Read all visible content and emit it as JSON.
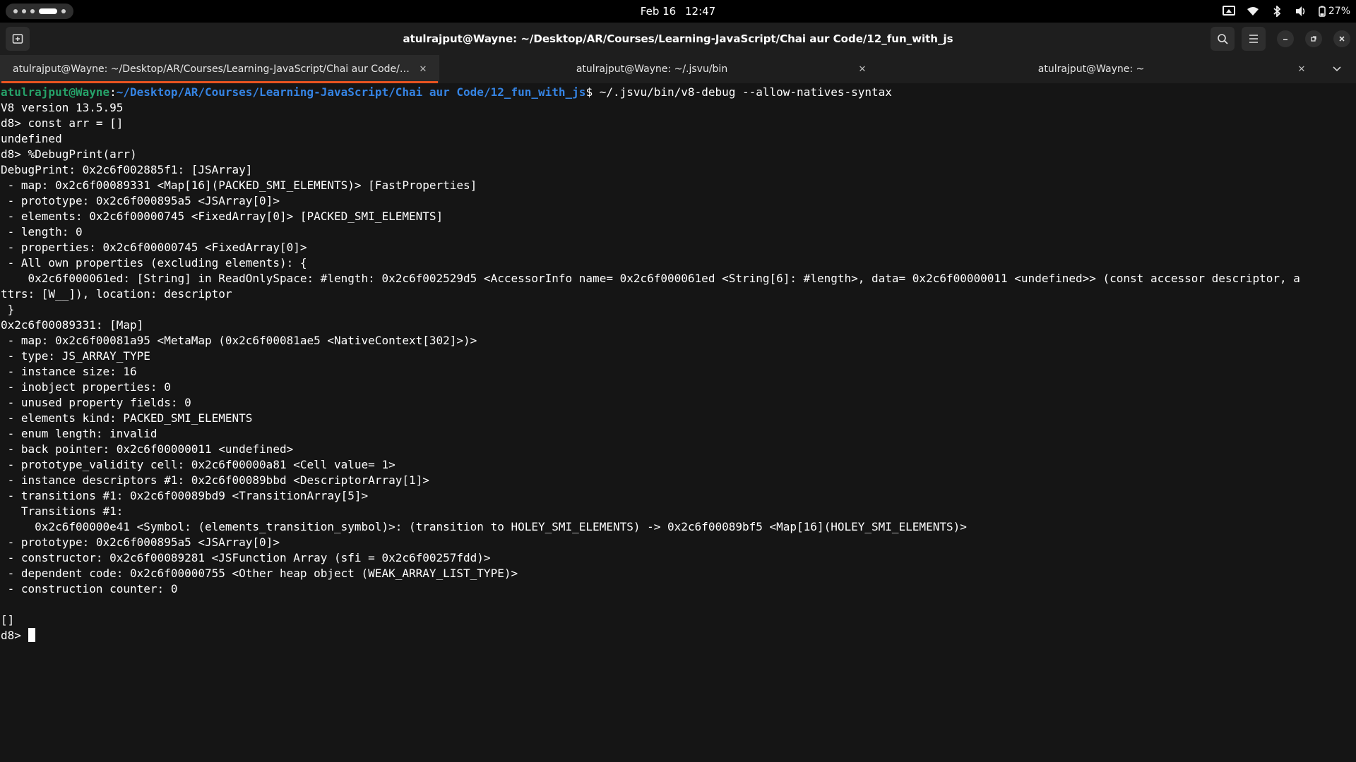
{
  "top_bar": {
    "date": "Feb 16",
    "time": "12:47",
    "battery": "27%"
  },
  "window": {
    "title": "atulrajput@Wayne: ~/Desktop/AR/Courses/Learning-JavaScript/Chai aur Code/12_fun_with_js"
  },
  "tabs": [
    {
      "label": "atulrajput@Wayne: ~/Desktop/AR/Courses/Learning-JavaScript/Chai aur Code/12_f...",
      "active": true
    },
    {
      "label": "atulrajput@Wayne: ~/.jsvu/bin",
      "active": false
    },
    {
      "label": "atulrajput@Wayne: ~",
      "active": false
    }
  ],
  "terminal": {
    "prompt_user": "atulrajput@Wayne",
    "prompt_path": "~/Desktop/AR/Courses/Learning-JavaScript/Chai aur Code/12_fun_with_js",
    "prompt_command": "$ ~/.jsvu/bin/v8-debug --allow-natives-syntax",
    "lines": [
      "V8 version 13.5.95",
      "d8> const arr = []",
      "undefined",
      "d8> %DebugPrint(arr)",
      "DebugPrint: 0x2c6f002885f1: [JSArray]",
      " - map: 0x2c6f00089331 <Map[16](PACKED_SMI_ELEMENTS)> [FastProperties]",
      " - prototype: 0x2c6f000895a5 <JSArray[0]>",
      " - elements: 0x2c6f00000745 <FixedArray[0]> [PACKED_SMI_ELEMENTS]",
      " - length: 0",
      " - properties: 0x2c6f00000745 <FixedArray[0]>",
      " - All own properties (excluding elements): {",
      "    0x2c6f000061ed: [String] in ReadOnlySpace: #length: 0x2c6f002529d5 <AccessorInfo name= 0x2c6f000061ed <String[6]: #length>, data= 0x2c6f00000011 <undefined>> (const accessor descriptor, a",
      "ttrs: [W__]), location: descriptor",
      " }",
      "0x2c6f00089331: [Map]",
      " - map: 0x2c6f00081a95 <MetaMap (0x2c6f00081ae5 <NativeContext[302]>)>",
      " - type: JS_ARRAY_TYPE",
      " - instance size: 16",
      " - inobject properties: 0",
      " - unused property fields: 0",
      " - elements kind: PACKED_SMI_ELEMENTS",
      " - enum length: invalid",
      " - back pointer: 0x2c6f00000011 <undefined>",
      " - prototype_validity cell: 0x2c6f00000a81 <Cell value= 1>",
      " - instance descriptors #1: 0x2c6f00089bbd <DescriptorArray[1]>",
      " - transitions #1: 0x2c6f00089bd9 <TransitionArray[5]>",
      "   Transitions #1:",
      "     0x2c6f00000e41 <Symbol: (elements_transition_symbol)>: (transition to HOLEY_SMI_ELEMENTS) -> 0x2c6f00089bf5 <Map[16](HOLEY_SMI_ELEMENTS)>",
      " - prototype: 0x2c6f000895a5 <JSArray[0]>",
      " - constructor: 0x2c6f00089281 <JSFunction Array (sfi = 0x2c6f00257fdd)>",
      " - dependent code: 0x2c6f00000755 <Other heap object (WEAK_ARRAY_LIST_TYPE)>",
      " - construction counter: 0",
      "",
      "[]"
    ],
    "final_prompt": "d8> "
  },
  "colors": {
    "accent": "#e95420",
    "user": "#26a269",
    "path": "#3584e4",
    "background": "#151515"
  },
  "icons": {
    "activities": "activities-indicator",
    "new_tab": "new-tab-icon",
    "search": "search-icon",
    "menu": "hamburger-menu-icon",
    "minimize": "minimize-icon",
    "maximize": "restore-icon",
    "close": "close-icon",
    "tab_list": "chevron-down-icon"
  }
}
